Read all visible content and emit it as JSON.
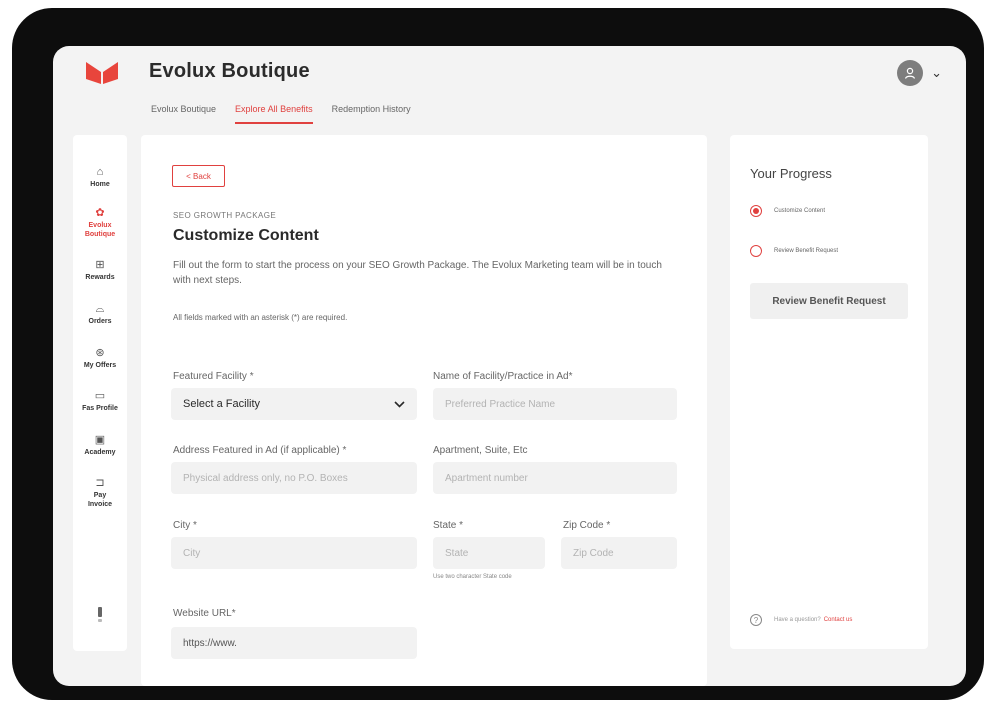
{
  "header": {
    "title": "Evolux Boutique",
    "nav": [
      "Evolux Boutique",
      "Explore All Benefits",
      "Redemption History"
    ],
    "active_nav_index": 1,
    "accent_color": "#e0413f"
  },
  "sidebar": {
    "items": [
      {
        "icon": "home-icon",
        "label_lines": [
          "Home"
        ]
      },
      {
        "icon": "boutique-icon",
        "label_lines": [
          "Evolux",
          "Boutique"
        ],
        "active": true
      },
      {
        "icon": "gift-icon",
        "label_lines": [
          "Rewards"
        ]
      },
      {
        "icon": "bag-icon",
        "label_lines": [
          "Orders"
        ]
      },
      {
        "icon": "offer-icon",
        "label_lines": [
          "My Offers"
        ]
      },
      {
        "icon": "profile-icon",
        "label_lines": [
          "Fas Profile"
        ]
      },
      {
        "icon": "academy-icon",
        "label_lines": [
          "Academy"
        ]
      },
      {
        "icon": "invoice-icon",
        "label_lines": [
          "Pay",
          "Invoice"
        ]
      }
    ]
  },
  "form": {
    "back_label": "< Back",
    "eyebrow": "SEO GROWTH PACKAGE",
    "title": "Customize Content",
    "intro": "Fill out the form to start the process on your SEO Growth Package. The Evolux Marketing team will be in touch with next steps.",
    "required_note": "All fields marked with an asterisk (*) are required.",
    "fields": {
      "facility": {
        "label": "Featured Facility *",
        "value": "Select a Facility"
      },
      "practice_name": {
        "label": "Name of Facility/Practice in Ad*",
        "placeholder": "Preferred Practice Name"
      },
      "address": {
        "label": "Address Featured in Ad (if applicable) *",
        "placeholder": "Physical address only, no P.O. Boxes"
      },
      "apartment": {
        "label": "Apartment, Suite, Etc",
        "placeholder": "Apartment number"
      },
      "city": {
        "label": "City *",
        "placeholder": "City"
      },
      "state": {
        "label": "State *",
        "placeholder": "State",
        "hint": "Use two character State code"
      },
      "zip": {
        "label": "Zip Code *",
        "placeholder": "Zip Code"
      },
      "website": {
        "label": "Website URL*",
        "value": "https://www."
      }
    }
  },
  "progress": {
    "title": "Your Progress",
    "steps": [
      {
        "label": "Customize Content",
        "active": true
      },
      {
        "label": "Review Benefit Request",
        "active": false
      }
    ],
    "button_label": "Review Benefit Request",
    "help_text": "Have a question?",
    "help_link": "Contact us"
  }
}
